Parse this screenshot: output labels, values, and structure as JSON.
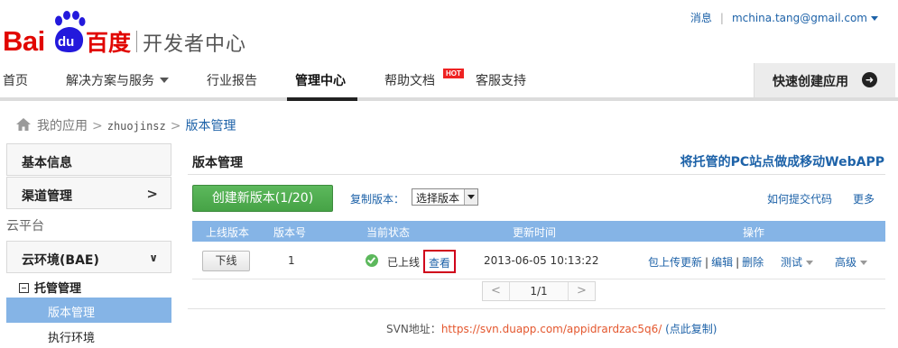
{
  "header": {
    "logo_bai": "Bai",
    "logo_du": "du",
    "logo_cn": "百度",
    "logo_subtitle": "开发者中心",
    "messages": "消息",
    "user_email": "mchina.tang@gmail.com",
    "brand_red": "#e10601",
    "paw_blue": "#2319dc"
  },
  "nav": {
    "items": [
      "首页",
      "解决方案与服务",
      "行业报告",
      "管理中心",
      "帮助文档",
      "客服支持"
    ],
    "active": "管理中心",
    "hot_badge": "HOT",
    "quick_create": "快速创建应用"
  },
  "breadcrumb": {
    "my_apps": "我的应用",
    "app_name": "zhuojinsz",
    "current": "版本管理"
  },
  "sidebar": {
    "basic_info": "基本信息",
    "channel_mgmt": "渠道管理",
    "cloud_platform": "云平台",
    "cloud_env": "云环境(BAE)",
    "hosting_mgmt": "托管管理",
    "version_mgmt": "版本管理",
    "exec_env": "执行环境"
  },
  "main": {
    "title": "版本管理",
    "webapp_link": "将托管的PC站点做成移动WebAPP",
    "create_button": "创建新版本(1/20)",
    "copy_version_label": "复制版本：",
    "version_select": "选择版本",
    "how_to_submit": "如何提交代码",
    "more": "更多",
    "accent_green": "#5cb85c",
    "table_header_color": "#85b4e6"
  },
  "table": {
    "headers": [
      "上线版本",
      "版本号",
      "当前状态",
      "更新时间",
      "操作"
    ],
    "rows": [
      {
        "action_button": "下线",
        "version": "1",
        "status": "已上线",
        "view": "查看",
        "updated": "2013-06-05 10:13:22",
        "ops": [
          "包上传更新",
          "编辑",
          "删除"
        ],
        "test": "测试",
        "advanced": "高级"
      }
    ]
  },
  "pager": {
    "prev": "<",
    "page": "1/1",
    "next": ">"
  },
  "svn": {
    "label": "SVN地址：",
    "url": "https://svn.duapp.com/appidrardzac5q6/",
    "copy": "(点此复制)"
  }
}
